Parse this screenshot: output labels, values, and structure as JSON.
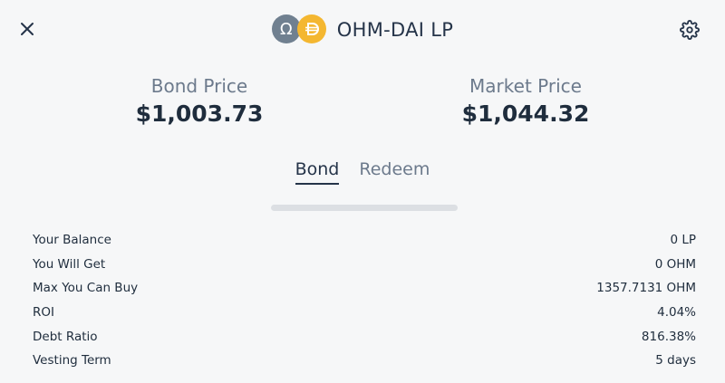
{
  "header": {
    "title": "OHM-DAI LP",
    "ohm_symbol": "Ω"
  },
  "prices": {
    "bond_label": "Bond Price",
    "bond_value": "$1,003.73",
    "market_label": "Market Price",
    "market_value": "$1,044.32"
  },
  "tabs": [
    {
      "label": "Bond",
      "active": true
    },
    {
      "label": "Redeem",
      "active": false
    }
  ],
  "details": [
    {
      "label": "Your Balance",
      "value": "0 LP"
    },
    {
      "label": "You Will Get",
      "value": "0 OHM"
    },
    {
      "label": "Max You Can Buy",
      "value": "1357.7131 OHM"
    },
    {
      "label": "ROI",
      "value": "4.04%"
    },
    {
      "label": "Debt Ratio",
      "value": "816.38%"
    },
    {
      "label": "Vesting Term",
      "value": "5 days"
    }
  ],
  "colors": {
    "ohm_token": "#708090",
    "dai_token": "#f4b731",
    "text_primary": "#1f2d3d",
    "text_muted": "#6c7a8c"
  },
  "icons": {
    "close": "close-icon",
    "settings": "gear-icon",
    "ohm": "ohm-token-icon",
    "dai": "dai-token-icon"
  }
}
